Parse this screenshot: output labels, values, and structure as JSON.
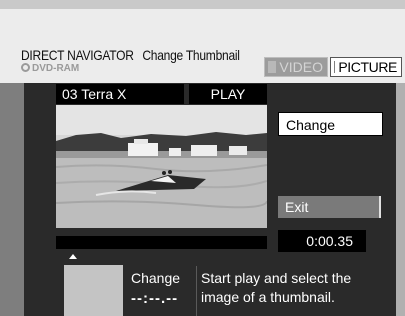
{
  "header": {
    "title": "DIRECT NAVIGATOR",
    "subtitle": "Change Thumbnail",
    "disc": "DVD-RAM",
    "modes": [
      {
        "label": "VIDEO",
        "active": false
      },
      {
        "label": "PICTURE",
        "active": true
      }
    ]
  },
  "player": {
    "title": "03 Terra X",
    "status": "PLAY",
    "time": "0:00.35"
  },
  "actions": {
    "change_label": "Change",
    "exit_label": "Exit"
  },
  "thumbnail": {
    "label": "Change",
    "time": "--:--.--"
  },
  "instruction": "Start play and select the image of a thumbnail.",
  "colors": {
    "panel": "#2a2a2a",
    "header": "#ececec",
    "highlight": "#ffffff",
    "inactive_button": "#7a7a7a"
  }
}
